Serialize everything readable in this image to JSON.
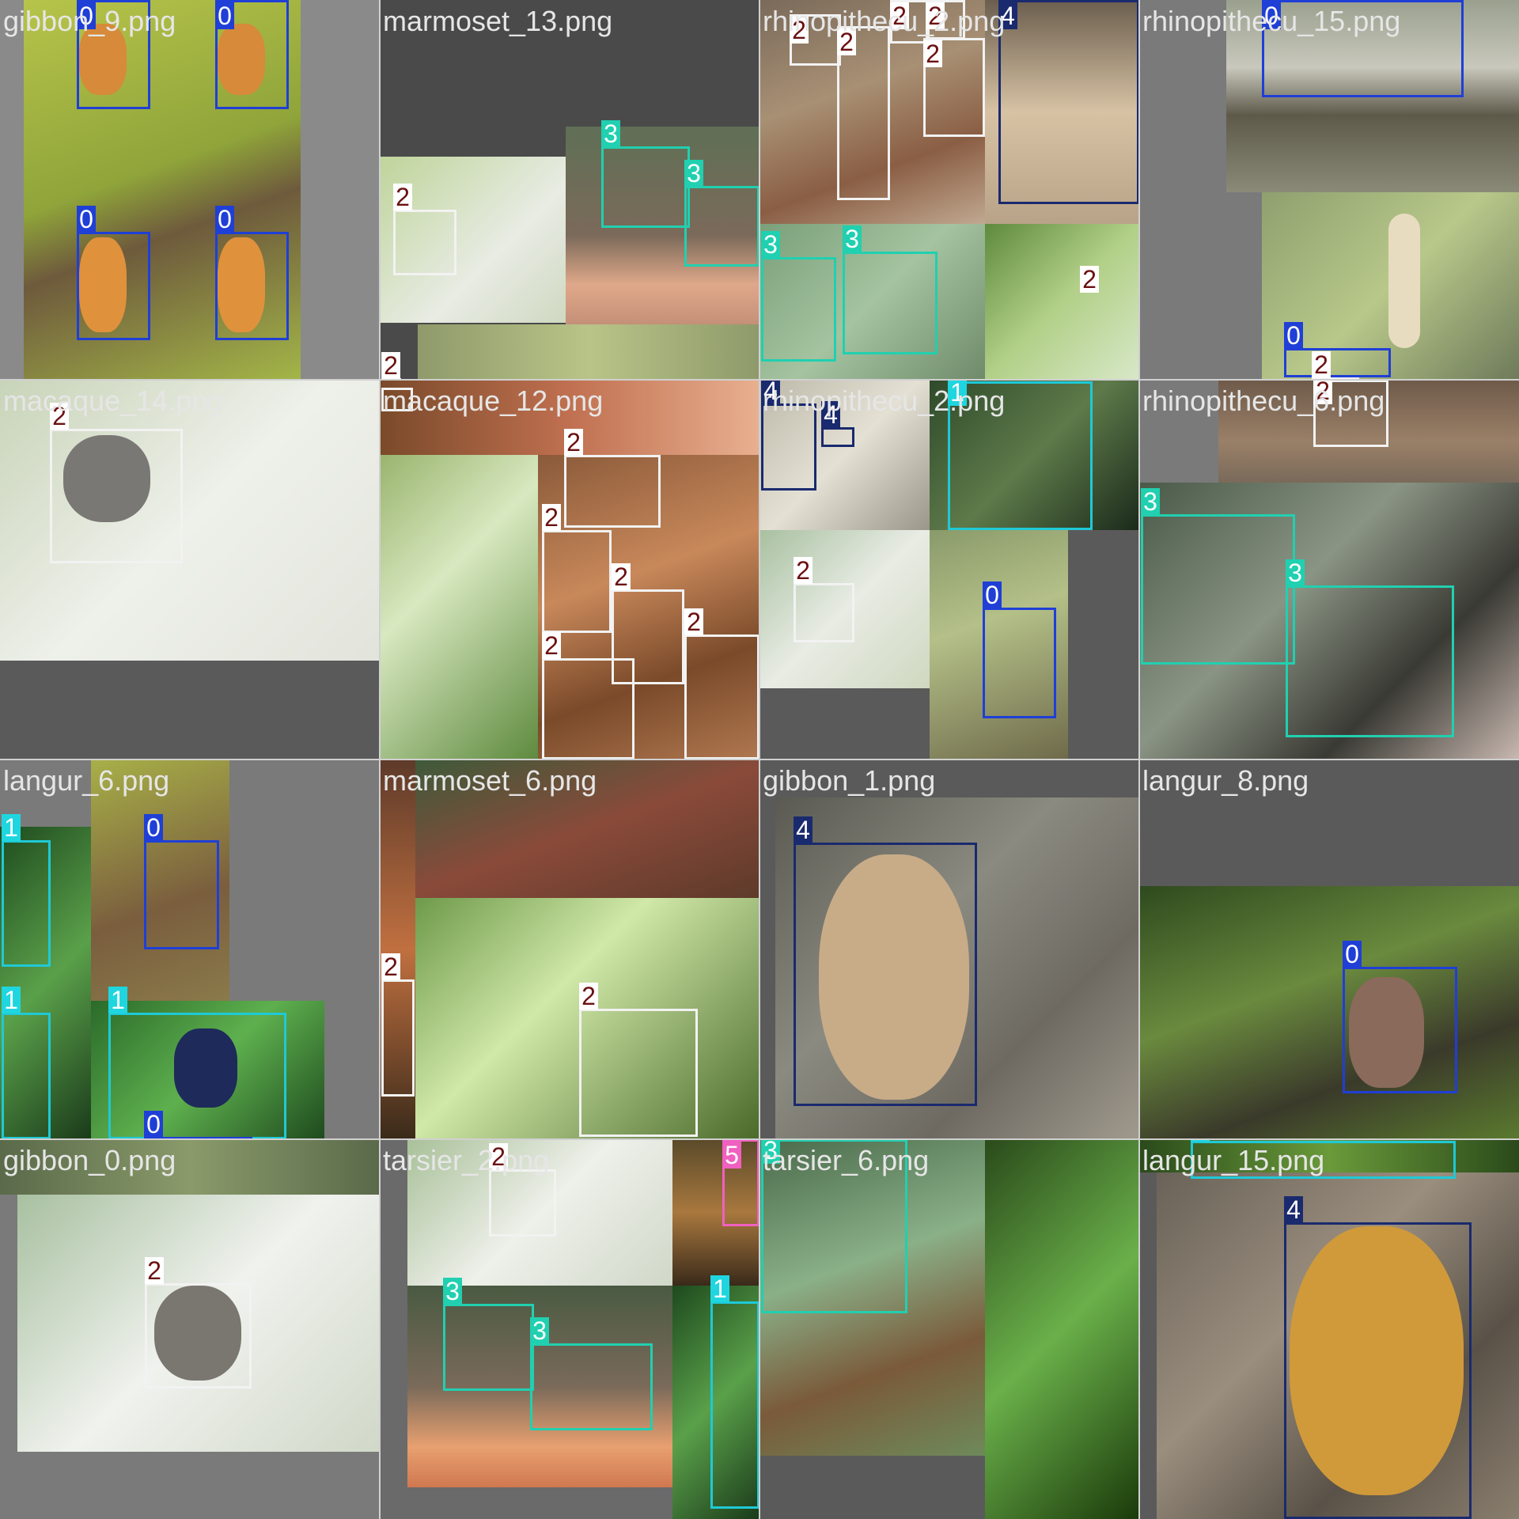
{
  "mosaic": {
    "tiles": [
      {
        "label": "gibbon_9.png",
        "boxes": [
          {
            "cls": "0"
          },
          {
            "cls": "0"
          },
          {
            "cls": "0"
          },
          {
            "cls": "0"
          }
        ]
      },
      {
        "label": "marmoset_13.png",
        "boxes": [
          {
            "cls": "3"
          },
          {
            "cls": "3"
          },
          {
            "cls": "2"
          },
          {
            "cls": "2"
          }
        ]
      },
      {
        "label": "rhinopithecu_2.png",
        "boxes": [
          {
            "cls": "2"
          },
          {
            "cls": "2"
          },
          {
            "cls": "2"
          },
          {
            "cls": "2"
          },
          {
            "cls": "2"
          },
          {
            "cls": "4"
          },
          {
            "cls": "3"
          },
          {
            "cls": "3"
          },
          {
            "cls": "2"
          }
        ]
      },
      {
        "label": "rhinopithecu_15.png",
        "boxes": [
          {
            "cls": "0"
          },
          {
            "cls": "0"
          },
          {
            "cls": "2"
          }
        ]
      },
      {
        "label": "macaque_14.png",
        "boxes": [
          {
            "cls": "2"
          }
        ]
      },
      {
        "label": "macaque_12.png",
        "boxes": [
          {
            "cls": "2"
          },
          {
            "cls": "2"
          },
          {
            "cls": "2"
          },
          {
            "cls": "2"
          },
          {
            "cls": "2"
          },
          {
            "cls": "2"
          }
        ]
      },
      {
        "label": "rhinopithecu_2.png",
        "boxes": [
          {
            "cls": "4"
          },
          {
            "cls": "4"
          },
          {
            "cls": "1"
          },
          {
            "cls": "2"
          },
          {
            "cls": "0"
          }
        ]
      },
      {
        "label": "rhinopithecu_6.png",
        "boxes": [
          {
            "cls": "2"
          },
          {
            "cls": "3"
          },
          {
            "cls": "3"
          }
        ]
      },
      {
        "label": "langur_6.png",
        "boxes": [
          {
            "cls": "1"
          },
          {
            "cls": "0"
          },
          {
            "cls": "1"
          },
          {
            "cls": "1"
          },
          {
            "cls": "0"
          }
        ]
      },
      {
        "label": "marmoset_6.png",
        "boxes": [
          {
            "cls": "2"
          },
          {
            "cls": "2"
          }
        ]
      },
      {
        "label": "gibbon_1.png",
        "boxes": [
          {
            "cls": "4"
          }
        ]
      },
      {
        "label": "langur_8.png",
        "boxes": [
          {
            "cls": "0"
          }
        ]
      },
      {
        "label": "gibbon_0.png",
        "boxes": [
          {
            "cls": "2"
          }
        ]
      },
      {
        "label": "tarsier_2.png",
        "boxes": [
          {
            "cls": "2"
          },
          {
            "cls": "5"
          },
          {
            "cls": "3"
          },
          {
            "cls": "3"
          },
          {
            "cls": "1"
          }
        ]
      },
      {
        "label": "tarsier_6.png",
        "boxes": [
          {
            "cls": "3"
          }
        ]
      },
      {
        "label": "langur_15.png",
        "boxes": [
          {
            "cls": "1"
          },
          {
            "cls": "4"
          }
        ]
      }
    ]
  },
  "class_colors": {
    "0": {
      "border": "#1f3fd6",
      "bg": "#1f3fd6",
      "fg": "#ffffff"
    },
    "1": {
      "border": "#1fc9d6",
      "bg": "#1fd6e0",
      "fg": "#ffffff"
    },
    "2": {
      "border": "#f2f2f2",
      "bg": "#ffffff",
      "fg": "#6b1010"
    },
    "3": {
      "border": "#20d0b0",
      "bg": "#20d0b0",
      "fg": "#ffffff"
    },
    "4": {
      "border": "#1a2a6e",
      "bg": "#1a2a6e",
      "fg": "#ffffff"
    },
    "5": {
      "border": "#f060c0",
      "bg": "#f060c0",
      "fg": "#ffffff"
    }
  }
}
